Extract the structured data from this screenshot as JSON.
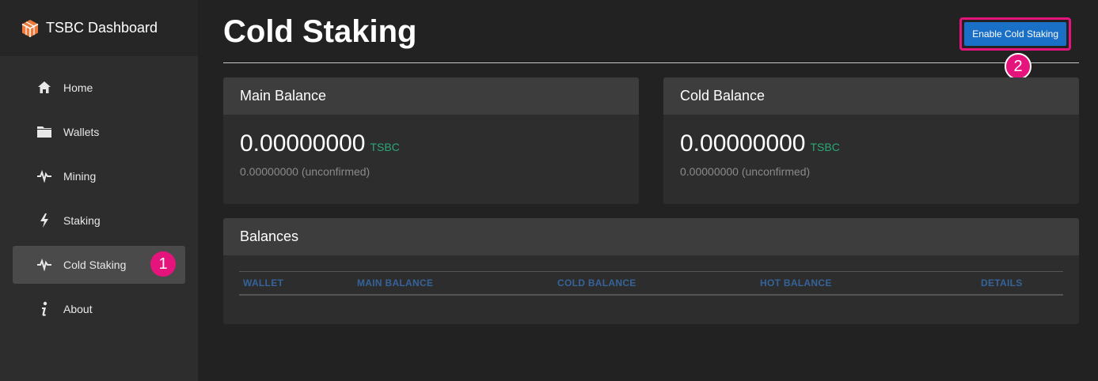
{
  "brand": {
    "title": "TSBC Dashboard",
    "logo_icon": "cube-logo-icon",
    "logo_color": "#f07a3a"
  },
  "sidebar": {
    "items": [
      {
        "label": "Home",
        "icon": "home-icon"
      },
      {
        "label": "Wallets",
        "icon": "folder-icon"
      },
      {
        "label": "Mining",
        "icon": "pulse-icon"
      },
      {
        "label": "Staking",
        "icon": "lightning-icon"
      },
      {
        "label": "Cold Staking",
        "icon": "pulse-icon",
        "active": true,
        "marker": "1"
      },
      {
        "label": "About",
        "icon": "info-icon"
      }
    ]
  },
  "header": {
    "title": "Cold Staking",
    "enable_button": "Enable Cold Staking",
    "marker": "2"
  },
  "main_balance": {
    "title": "Main Balance",
    "amount": "0.00000000",
    "unit": "TSBC",
    "unconfirmed": "0.00000000 (unconfirmed)"
  },
  "cold_balance": {
    "title": "Cold Balance",
    "amount": "0.00000000",
    "unit": "TSBC",
    "unconfirmed": "0.00000000 (unconfirmed)"
  },
  "balances": {
    "title": "Balances",
    "columns": [
      "WALLET",
      "MAIN BALANCE",
      "COLD BALANCE",
      "HOT BALANCE",
      "DETAILS"
    ],
    "rows": []
  },
  "colors": {
    "accent": "#1a6fc7",
    "highlight": "#e5147c",
    "unit_green": "#2aa876",
    "table_header": "#35639a"
  }
}
